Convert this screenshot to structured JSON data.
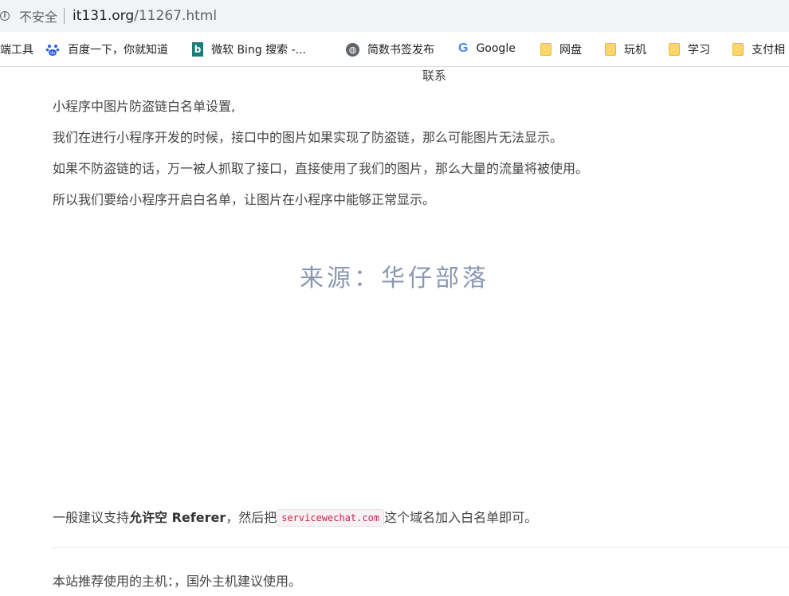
{
  "browser": {
    "security_label": "不安全",
    "url_host": "it131.org",
    "url_path": "/11267.html"
  },
  "bookmarks": [
    {
      "label": "端工具",
      "icon": "none"
    },
    {
      "label": "百度一下，你就知道",
      "icon": "baidu-paw-icon"
    },
    {
      "label": "微软 Bing 搜索 -...",
      "icon": "bing-icon"
    },
    {
      "label": "简数书签发布",
      "icon": "globe-icon"
    },
    {
      "label": "Google",
      "icon": "google-icon"
    },
    {
      "label": "网盘",
      "icon": "folder-icon"
    },
    {
      "label": "玩机",
      "icon": "folder-icon"
    },
    {
      "label": "学习",
      "icon": "folder-icon"
    },
    {
      "label": "支付相",
      "icon": "folder-icon"
    }
  ],
  "article": {
    "truncated_top": "联系",
    "paragraphs": [
      "小程序中图片防盗链白名单设置,",
      "我们在进行小程序开发的时候，接口中的图片如果实现了防盗链，那么可能图片无法显示。",
      "如果不防盗链的话，万一被人抓取了接口，直接使用了我们的图片，那么大量的流量将被使用。",
      "所以我们要给小程序开启白名单，让图片在小程序中能够正常显示。"
    ],
    "watermark": "来源：华仔部落",
    "suggestion": {
      "before": "一般建议支持",
      "bold": "允许空 Referer",
      "middle": "，然后把",
      "code": "servicewechat.com",
      "after": "这个域名加入白名单即可。"
    },
    "footer_text": "本站推荐使用的主机：，国外主机建议使用。"
  }
}
